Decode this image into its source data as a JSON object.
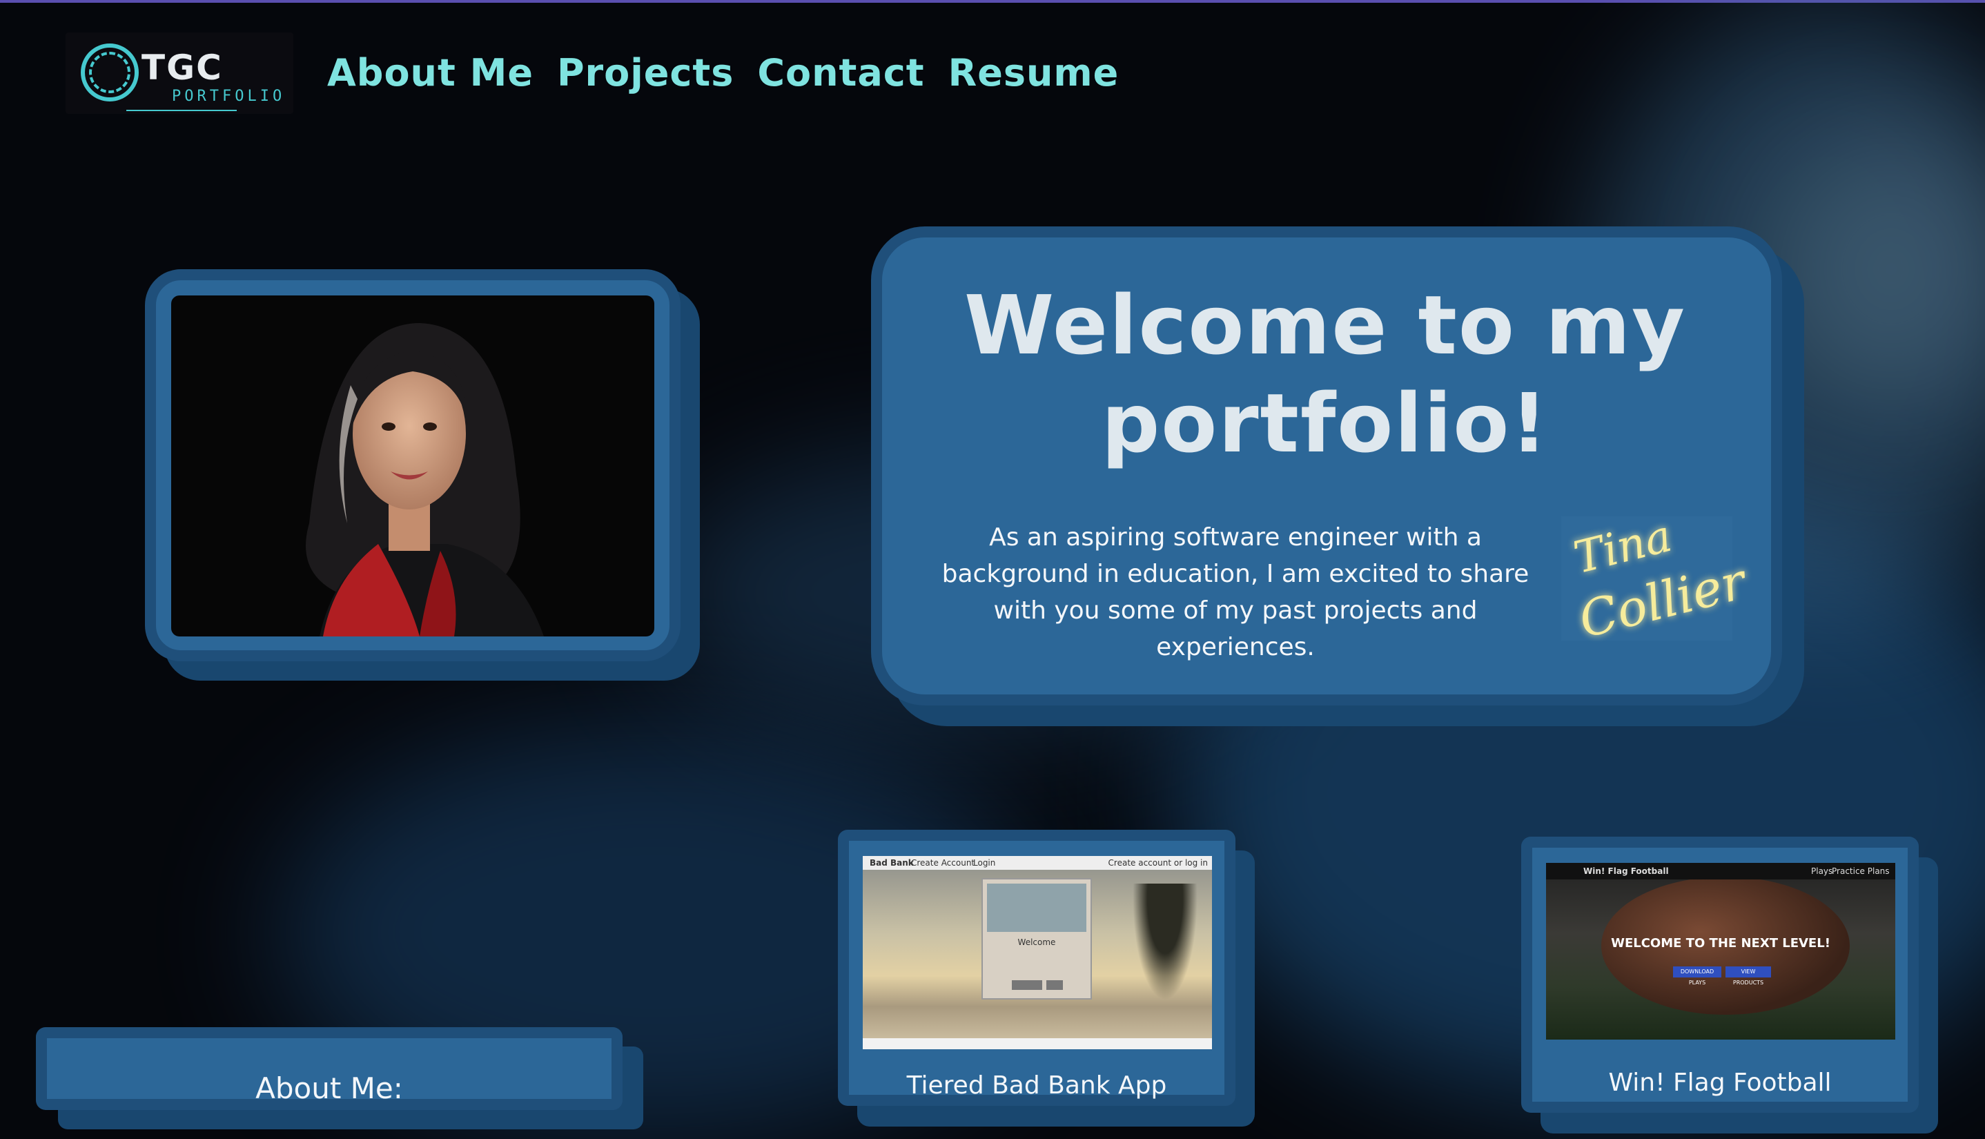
{
  "brand": {
    "logo_main": "TGC",
    "logo_sub": "PORTFOLIO"
  },
  "nav": [
    {
      "label": "About Me"
    },
    {
      "label": "Projects"
    },
    {
      "label": "Contact"
    },
    {
      "label": "Resume"
    }
  ],
  "hero": {
    "title": "Welcome to my portfolio!",
    "intro": "As an aspiring software engineer with a background in education, I am excited to share with you some of my past projects and experiences.",
    "signature_line1": "Tina",
    "signature_line2": "Collier"
  },
  "about": {
    "heading": "About Me:"
  },
  "projects": [
    {
      "title": "Tiered Bad Bank App",
      "preview": {
        "brand": "Bad Bank",
        "nav1": "Create Account",
        "nav2": "Login",
        "corner": "Create account or log in",
        "modal_title": "Welcome"
      }
    },
    {
      "title": "Win! Flag Football",
      "preview": {
        "brand": "Win! Flag Football",
        "nav1": "Plays",
        "nav2": "Practice Plans",
        "headline": "WELCOME TO THE NEXT LEVEL!",
        "btn1": "DOWNLOAD PLAYS",
        "btn2": "VIEW PRODUCTS"
      }
    }
  ]
}
